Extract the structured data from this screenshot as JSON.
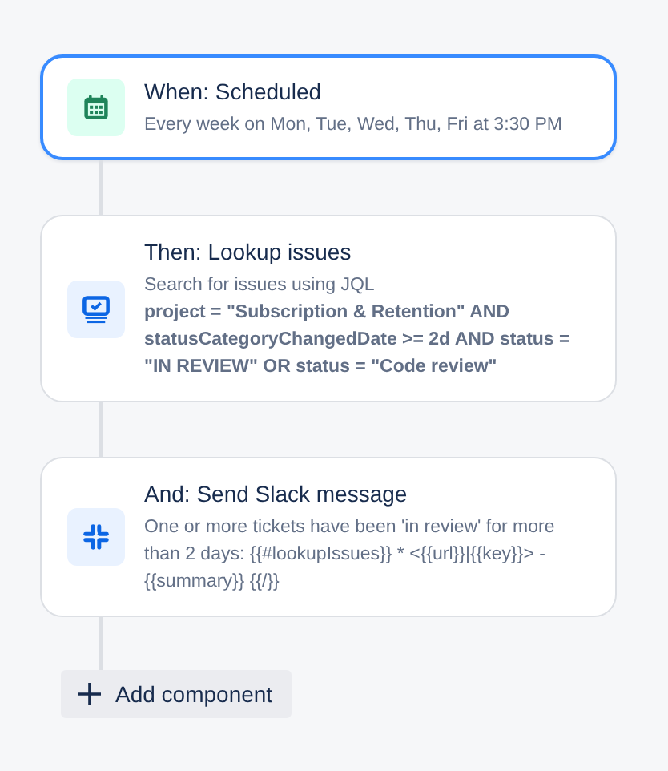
{
  "steps": [
    {
      "kind": "schedule",
      "title": "When: Scheduled",
      "description": "Every week on Mon, Tue, Wed, Thu, Fri at 3:30 PM",
      "selected": true
    },
    {
      "kind": "lookup",
      "title": "Then: Lookup issues",
      "description": "Search for issues using JQL",
      "query": "project = \"Subscription & Retention\" AND statusCategoryChangedDate >= 2d AND status = \"IN REVIEW\" OR status = \"Code review\"",
      "selected": false
    },
    {
      "kind": "slack",
      "title": "And: Send Slack message",
      "description": "One or more tickets have been 'in review' for more than 2 days: {{#lookupIssues}} * <{{url}}|{{key}}> - {{summary}} {{/}}",
      "selected": false
    }
  ],
  "add_button": {
    "label": "Add component"
  }
}
